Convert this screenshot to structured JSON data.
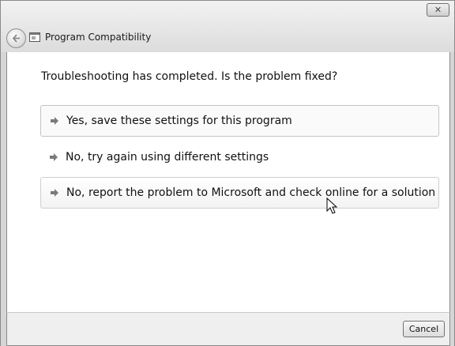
{
  "window": {
    "title": "Program Compatibility",
    "close_label": "✕"
  },
  "content": {
    "question": "Troubleshooting has completed.  Is the problem fixed?",
    "options": [
      {
        "label": "Yes, save these settings for this program",
        "icon": "arrow-right-icon"
      },
      {
        "label": "No, try again using different settings",
        "icon": "arrow-right-icon"
      },
      {
        "label": "No, report the problem to Microsoft and check online for a solution",
        "icon": "arrow-right-icon"
      }
    ]
  },
  "footer": {
    "cancel_label": "Cancel"
  }
}
